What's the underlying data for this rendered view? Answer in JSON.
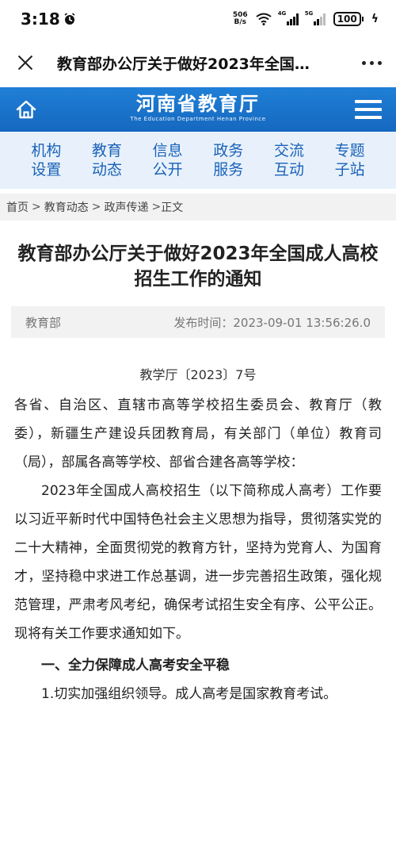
{
  "status_bar": {
    "time": "3:18",
    "net_speed_value": "506",
    "net_speed_unit": "B/s",
    "signal_1_label": "4G",
    "signal_2_label": "5G",
    "battery": "100"
  },
  "title_bar": {
    "title": "教育部办公厅关于做好2023年全国…"
  },
  "site_header": {
    "logo_cn": "河南省教育厅",
    "logo_en": "The Education Department Henan Province"
  },
  "nav": {
    "items": [
      {
        "line1": "机构",
        "line2": "设置"
      },
      {
        "line1": "教育",
        "line2": "动态"
      },
      {
        "line1": "信息",
        "line2": "公开"
      },
      {
        "line1": "政务",
        "line2": "服务"
      },
      {
        "line1": "交流",
        "line2": "互动"
      },
      {
        "line1": "专题",
        "line2": "子站"
      }
    ]
  },
  "breadcrumb": {
    "home": "首页",
    "level1": "教育动态",
    "level2": "政声传递",
    "current": "正文",
    "separator": ">"
  },
  "article": {
    "title": "教育部办公厅关于做好2023年全国成人高校招生工作的通知",
    "source": "教育部",
    "publish_label": "发布时间：",
    "publish_time": "2023-09-01 13:56:26.0",
    "doc_number": "教学厅〔2023〕7号",
    "recipients": "各省、自治区、直辖市高等学校招生委员会、教育厅（教委），新疆生产建设兵团教育局，有关部门（单位）教育司（局），部属各高等学校、部省合建各高等学校：",
    "para1": "2023年全国成人高校招生（以下简称成人高考）工作要以习近平新时代中国特色社会主义思想为指导，贯彻落实党的二十大精神，全面贯彻党的教育方针，坚持为党育人、为国育才，坚持稳中求进工作总基调，进一步完善招生政策，强化规范管理，严肃考风考纪，确保考试招生安全有序、公平公正。现将有关工作要求通知如下。",
    "heading1": "一、全力保障成人高考安全平稳",
    "para2": "1.切实加强组织领导。成人高考是国家教育考试。"
  }
}
